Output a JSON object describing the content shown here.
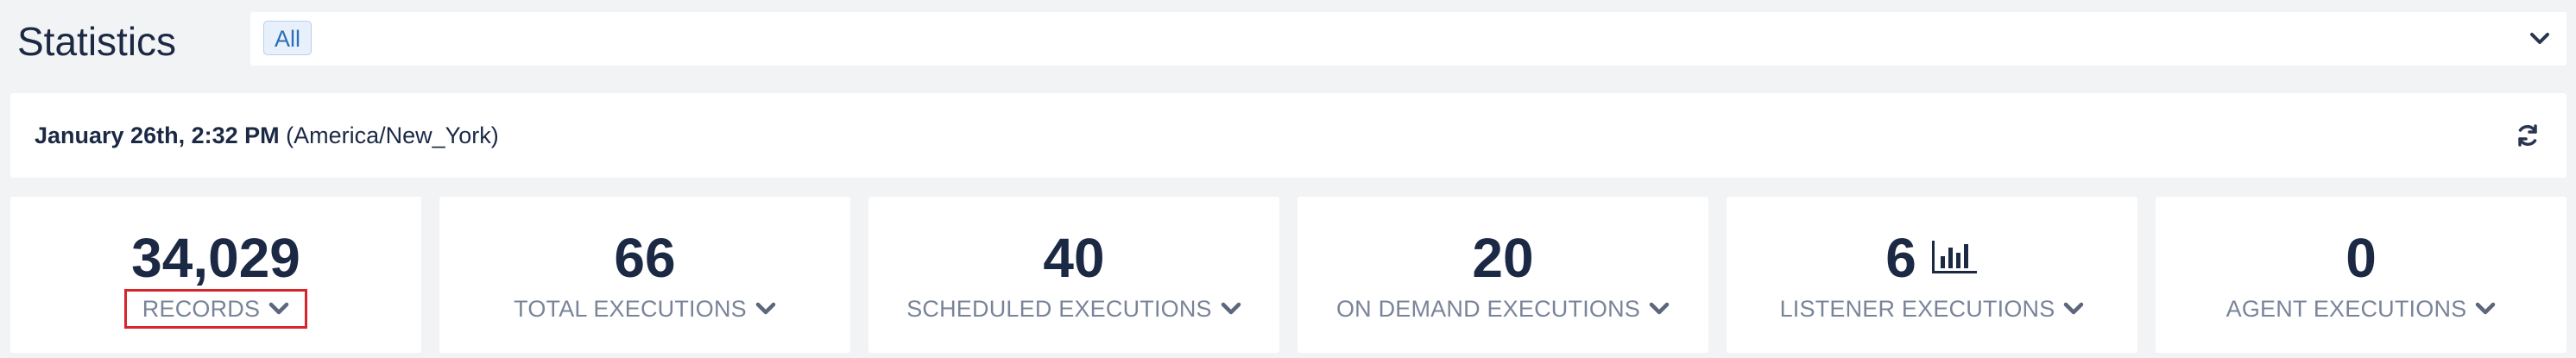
{
  "header": {
    "title": "Statistics"
  },
  "filter": {
    "selected_chip": "All"
  },
  "datebar": {
    "date_bold": "January 26th, 2:32 PM",
    "timezone": "(America/New_York)"
  },
  "stats": [
    {
      "value": "34,029",
      "label": "RECORDS",
      "highlighted": true
    },
    {
      "value": "66",
      "label": "TOTAL EXECUTIONS"
    },
    {
      "value": "40",
      "label": "SCHEDULED EXECUTIONS"
    },
    {
      "value": "20",
      "label": "ON DEMAND EXECUTIONS"
    },
    {
      "value": "6",
      "label": "LISTENER EXECUTIONS",
      "icon": "bar-chart-icon"
    },
    {
      "value": "0",
      "label": "AGENT EXECUTIONS"
    }
  ],
  "colors": {
    "background": "#f2f3f5",
    "text_primary": "#1c2945",
    "text_secondary": "#7a8499",
    "chip_background": "#e8f1fb",
    "chip_text": "#2b6fb6",
    "highlight_border": "#d7262b"
  }
}
